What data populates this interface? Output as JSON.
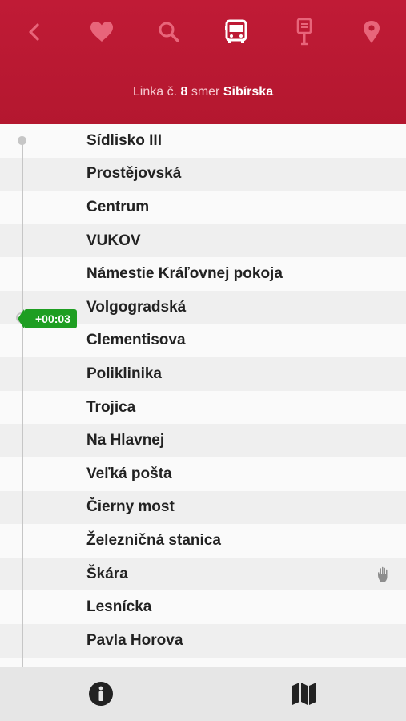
{
  "header": {
    "line_prefix": "Linka č.",
    "line_number": "8",
    "direction_prefix": "smer",
    "direction": "Sibírska"
  },
  "nav": {
    "icons": [
      "back-icon",
      "heart-icon",
      "search-icon",
      "bus-icon",
      "stop-sign-icon",
      "location-pin-icon"
    ],
    "active": "bus-icon"
  },
  "stops": [
    "Sídlisko III",
    "Prostějovská",
    "Centrum",
    "VUKOV",
    "Námestie Kráľovnej pokoja",
    "Volgogradská",
    "Clementisova",
    "Poliklinika",
    "Trojica",
    "Na Hlavnej",
    "Veľká pošta",
    "Čierny most",
    "Železničná stanica",
    "Škára",
    "Lesnícka",
    "Pavla Horova"
  ],
  "vehicle": {
    "delay": "+00:03"
  },
  "request_stop_icon": "hand-icon",
  "bottom": {
    "icons": [
      "info-icon",
      "map-icon"
    ]
  },
  "colors": {
    "header": "#b91a32",
    "delay_badge": "#1e9e22",
    "timeline": "#c6c6c6"
  }
}
